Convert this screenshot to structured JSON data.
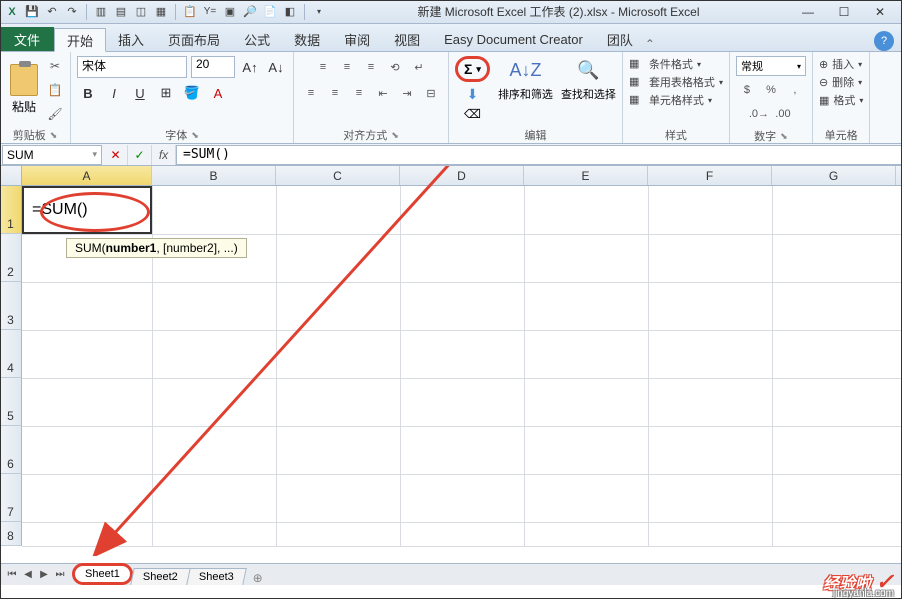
{
  "app": {
    "title": "新建 Microsoft Excel 工作表 (2).xlsx - Microsoft Excel"
  },
  "menutabs": {
    "file": "文件",
    "tabs": [
      "开始",
      "插入",
      "页面布局",
      "公式",
      "数据",
      "审阅",
      "视图",
      "Easy Document Creator",
      "团队"
    ],
    "active": "开始"
  },
  "ribbon": {
    "clipboard": {
      "label": "剪贴板",
      "paste": "粘贴"
    },
    "font": {
      "label": "字体",
      "family": "宋体",
      "size": "20",
      "bold": "B",
      "italic": "I",
      "underline": "U"
    },
    "align": {
      "label": "对齐方式"
    },
    "editing": {
      "label": "编辑",
      "autosum": "Σ",
      "sort": "排序和筛选",
      "find": "查找和选择"
    },
    "styles": {
      "label": "样式",
      "cond": "条件格式",
      "tablefmt": "套用表格格式",
      "cellstyle": "单元格样式"
    },
    "number": {
      "label": "数字",
      "format": "常规"
    },
    "cells": {
      "label": "单元格",
      "insert": "插入",
      "delete": "删除",
      "format": "格式"
    }
  },
  "formulabar": {
    "namebox": "SUM",
    "formula": "=SUM()"
  },
  "grid": {
    "cols": [
      "A",
      "B",
      "C",
      "D",
      "E",
      "F",
      "G"
    ],
    "rows": [
      "1",
      "2",
      "3",
      "4",
      "5",
      "6",
      "7",
      "8"
    ],
    "active_cell": "=SUM()",
    "tooltip_fn": "SUM(",
    "tooltip_b": "number1",
    "tooltip_rest": ", [number2], ...)"
  },
  "sheets": {
    "list": [
      "Sheet1",
      "Sheet2",
      "Sheet3"
    ],
    "active": "Sheet1"
  },
  "watermark": {
    "text": "经验啦",
    "url": "jingyanla.com"
  }
}
